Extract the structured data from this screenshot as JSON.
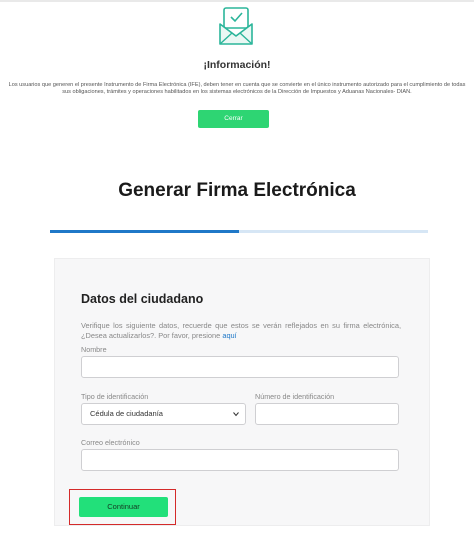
{
  "notice": {
    "title": "¡Información!",
    "text": "Los usuarios que generen el presente Instrumento de Firma Electrónica (IFE), deben tener en cuenta que se convierte en el único instrumento autorizado para el cumplimiento de todas sus obligaciones, trámites y operaciones habilitados en los sistemas electrónicos de la Dirección de Impuestos y Aduanas Nacionales- DIAN.",
    "close_label": "Cerrar",
    "icon": "envelope-check-icon",
    "accent": "#2ed573"
  },
  "page": {
    "title": "Generar Firma Electrónica",
    "progress_percent": 50,
    "progress_color": "#1f78c8"
  },
  "form": {
    "title": "Datos del ciudadano",
    "description": "Verifique los siguiente datos, recuerde que estos se verán reflejados en su firma electrónica, ¿Desea actualizarlos?. Por favor, presione",
    "link_text": "aquí",
    "fields": {
      "name_label": "Nombre",
      "name_value": "",
      "id_type_label": "Tipo de identificación",
      "id_type_value": "Cédula de ciudadanía",
      "id_number_label": "Número de identificación",
      "id_number_value": "",
      "email_label": "Correo electrónico",
      "email_value": ""
    },
    "continue_label": "Continuar",
    "continue_color": "#22e07a",
    "highlight_color": "#d42a2a"
  }
}
